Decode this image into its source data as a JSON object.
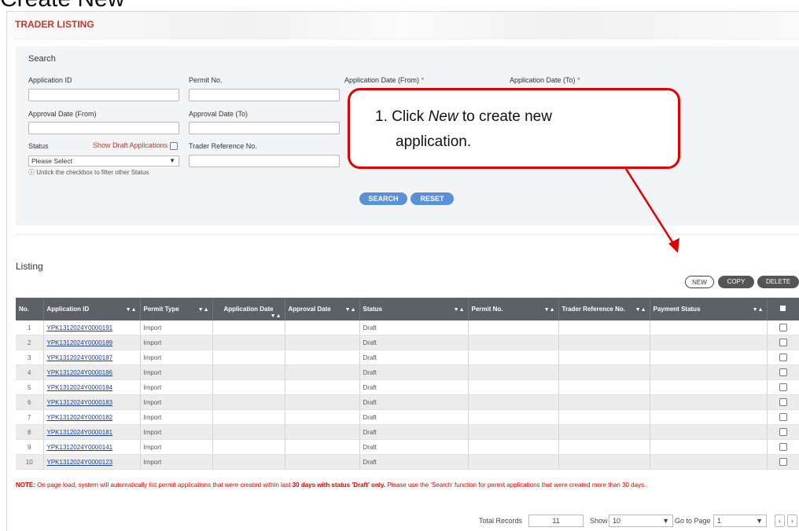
{
  "header": {
    "overlay_title": "Create New",
    "page_title": "TRADER LISTING"
  },
  "search": {
    "title": "Search",
    "application_id_label": "Application ID",
    "permit_no_label": "Permit No.",
    "app_date_from_label": "Application Date (From)",
    "app_date_to_label": "Application Date (To)",
    "required_mark": "*",
    "approval_from_label": "Approval Date (From)",
    "approval_to_label": "Approval Date (To)",
    "status_label": "Status",
    "show_draft_label": "Show Draft Applications",
    "trader_ref_label": "Trader Reference No.",
    "status_value": "Please Select",
    "hint": "ⓘ Untick the checkbox to filter other Status",
    "search_button": "SEARCH",
    "reset_button": "RESET"
  },
  "callout": {
    "line1_prefix": "1.  Click ",
    "line1_em": "New",
    "line1_suffix": " to create new",
    "line2": "application."
  },
  "listing": {
    "title": "Listing",
    "new_button": "NEW",
    "copy_button": "COPY",
    "delete_button": "DELETE",
    "columns": [
      "No.",
      "Application ID",
      "Permit Type",
      "Application Date",
      "Approval Date",
      "Status",
      "Permit No.",
      "Trader Reference No.",
      "Payment Status"
    ],
    "sort_glyph": "▼▲",
    "rows": [
      {
        "no": "1",
        "app_id": "YPK1312024Y0000191",
        "type": "Import",
        "status": "Draft"
      },
      {
        "no": "2",
        "app_id": "YPK1312024Y0000189",
        "type": "Import",
        "status": "Draft"
      },
      {
        "no": "3",
        "app_id": "YPK1312024Y0000187",
        "type": "Import",
        "status": "Draft"
      },
      {
        "no": "4",
        "app_id": "YPK1312024Y0000186",
        "type": "Import",
        "status": "Draft"
      },
      {
        "no": "5",
        "app_id": "YPK1312024Y0000184",
        "type": "Import",
        "status": "Draft"
      },
      {
        "no": "6",
        "app_id": "YPK1312024Y0000183",
        "type": "Import",
        "status": "Draft"
      },
      {
        "no": "7",
        "app_id": "YPK1312024Y0000182",
        "type": "Import",
        "status": "Draft"
      },
      {
        "no": "8",
        "app_id": "YPK1312024Y0000181",
        "type": "Import",
        "status": "Draft"
      },
      {
        "no": "9",
        "app_id": "YPK1312024Y0000141",
        "type": "Import",
        "status": "Draft"
      },
      {
        "no": "10",
        "app_id": "YPK1312024Y0000123",
        "type": "Import",
        "status": "Draft"
      }
    ]
  },
  "note": {
    "prefix": "NOTE:",
    "text1": " On page load, system will automatically list permit applications that were created within last ",
    "bold": "30 days with status 'Draft' only.",
    "text2": " Please use the 'Search' function for permit applications that were created more than 30 days."
  },
  "footer": {
    "total_label": "Total Records",
    "total_value": "11",
    "show_label": "Show",
    "show_value": "10",
    "goto_label": "Go to Page",
    "goto_value": "1",
    "prev": "‹",
    "next": "›"
  },
  "colors": {
    "accent_red": "#c0392b",
    "button_blue": "#5b8fd6",
    "header_gray": "#5c6168",
    "callout_red": "#e10000"
  }
}
